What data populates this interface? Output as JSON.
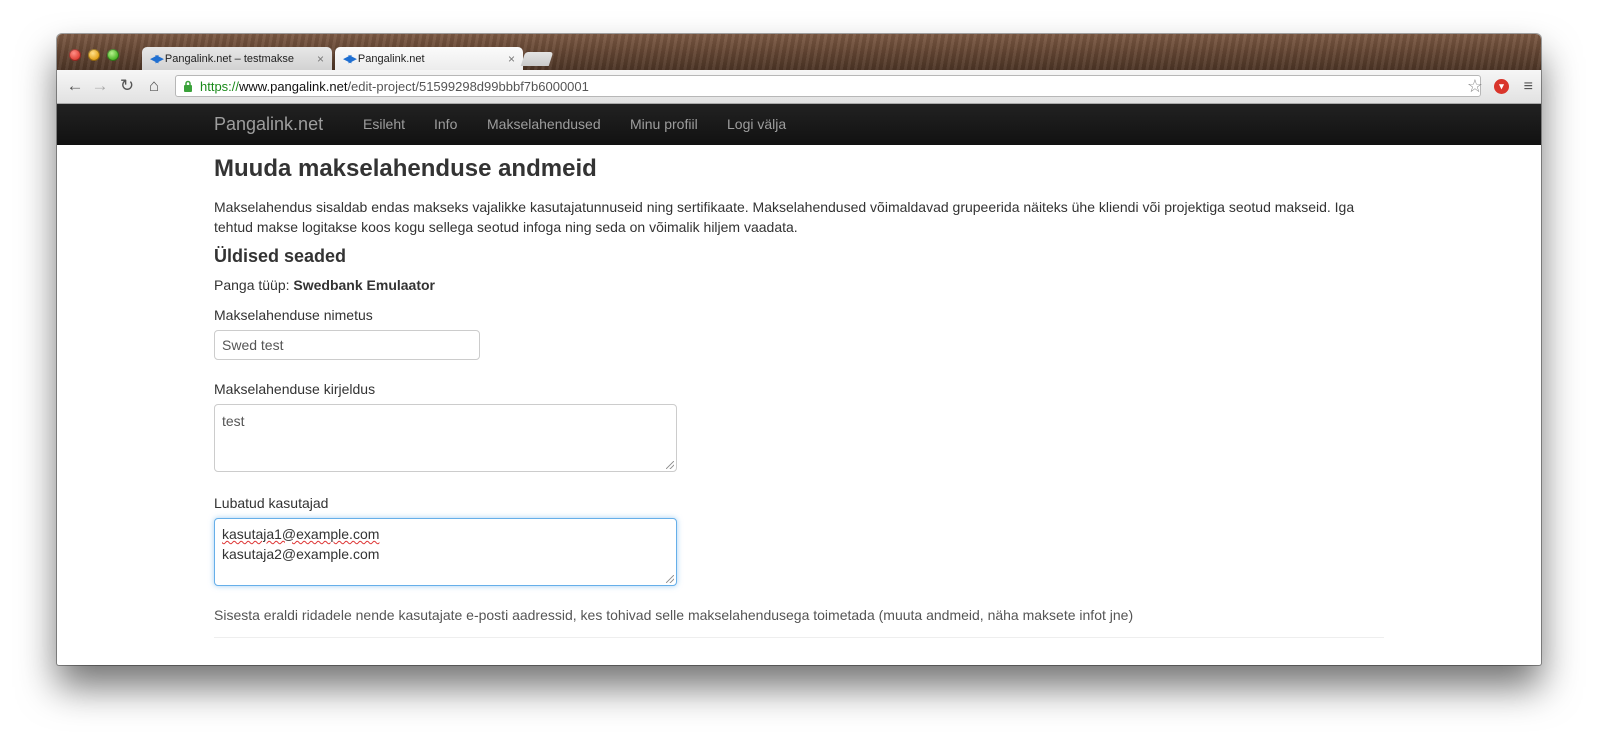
{
  "browser": {
    "tabs": [
      {
        "title": "Pangalink.net – testmakse",
        "close": "×"
      },
      {
        "title": "Pangalink.net",
        "close": "×"
      }
    ],
    "url": {
      "scheme": "https://",
      "host": "www.pangalink.net",
      "path": "/edit-project/51599298d99bbbf7b6000001"
    }
  },
  "navbar": {
    "brand": "Pangalink.net",
    "links": [
      "Esileht",
      "Info",
      "Makselahendused",
      "Minu profiil",
      "Logi välja"
    ]
  },
  "page": {
    "title": "Muuda makselahenduse andmeid",
    "intro": "Makselahendus sisaldab endas makseks vajalikke kasutajatunnuseid ning sertifikaate. Makselahendused võimaldavad grupeerida näiteks ühe kliendi või projektiga seotud makseid. Iga tehtud makse logitakse koos kogu sellega seotud infoga ning seda on võimalik hiljem vaadata.",
    "section_title": "Üldised seaded",
    "bank_type_label": "Panga tüüp:",
    "bank_type_value": "Swedbank Emulaator",
    "name_label": "Makselahenduse nimetus",
    "name_value": "Swed test",
    "description_label": "Makselahenduse kirjeldus",
    "description_value": "test",
    "users_label": "Lubatud kasutajad",
    "users": [
      "kasutaja1@example.com",
      "kasutaja2@example.com"
    ],
    "users_help": "Sisesta eraldi ridadele nende kasutajate e-posti aadressid, kes tohivad selle makselahendusega toimetada (muuta andmeid, näha maksete infot jne)"
  }
}
